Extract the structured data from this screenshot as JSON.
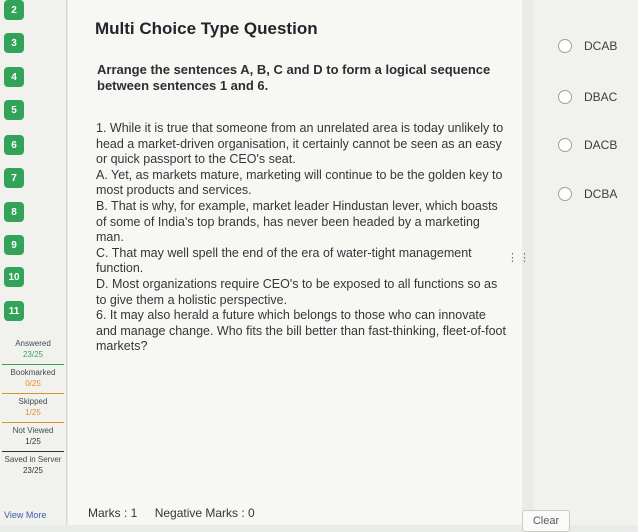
{
  "sidebar": {
    "question_numbers": [
      "2",
      "3",
      "4",
      "5",
      "6",
      "7",
      "8",
      "9",
      "10",
      "11"
    ],
    "stats": [
      {
        "label": "Answered",
        "value": "23/25",
        "color": "#3aa35a"
      },
      {
        "label": "Bookmarked",
        "value": "0/25",
        "color": "#e0902f"
      },
      {
        "label": "Skipped",
        "value": "1/25",
        "color": "#e0902f"
      },
      {
        "label": "Not Viewed",
        "value": "1/25",
        "color": "#333333"
      },
      {
        "label": "Saved in Server",
        "value": "23/25",
        "color": "#333333"
      }
    ],
    "view_more": "View More"
  },
  "question": {
    "title": "Multi Choice Type Question",
    "prompt": "Arrange the sentences A, B, C and D to form a logical sequence between sentences 1 and 6.",
    "sentences": [
      "1. While it is true that someone from an unrelated area is today unlikely to head a market-driven organisation, it certainly cannot be seen as an easy or quick passport to the CEO's seat.",
      "A. Yet, as markets mature, marketing will continue to be the golden key to most products and services.",
      "B. That is why, for example, market leader Hindustan lever, which boasts of some of India's top brands, has never been headed by a marketing man.",
      "C. That may well spell the end of the era of water-tight management function.",
      "D. Most organizations require CEO's to be exposed to all functions so as to give them a holistic perspective.",
      "6. It may also herald a future which belongs to those who can innovate and manage change. Who fits the bill better than fast-thinking, fleet-of-foot markets?"
    ]
  },
  "footer": {
    "marks": "Marks : 1",
    "negative_marks": "Negative Marks : 0"
  },
  "options": [
    "DCAB",
    "DBAC",
    "DACB",
    "DCBA"
  ],
  "clear_label": "Clear"
}
